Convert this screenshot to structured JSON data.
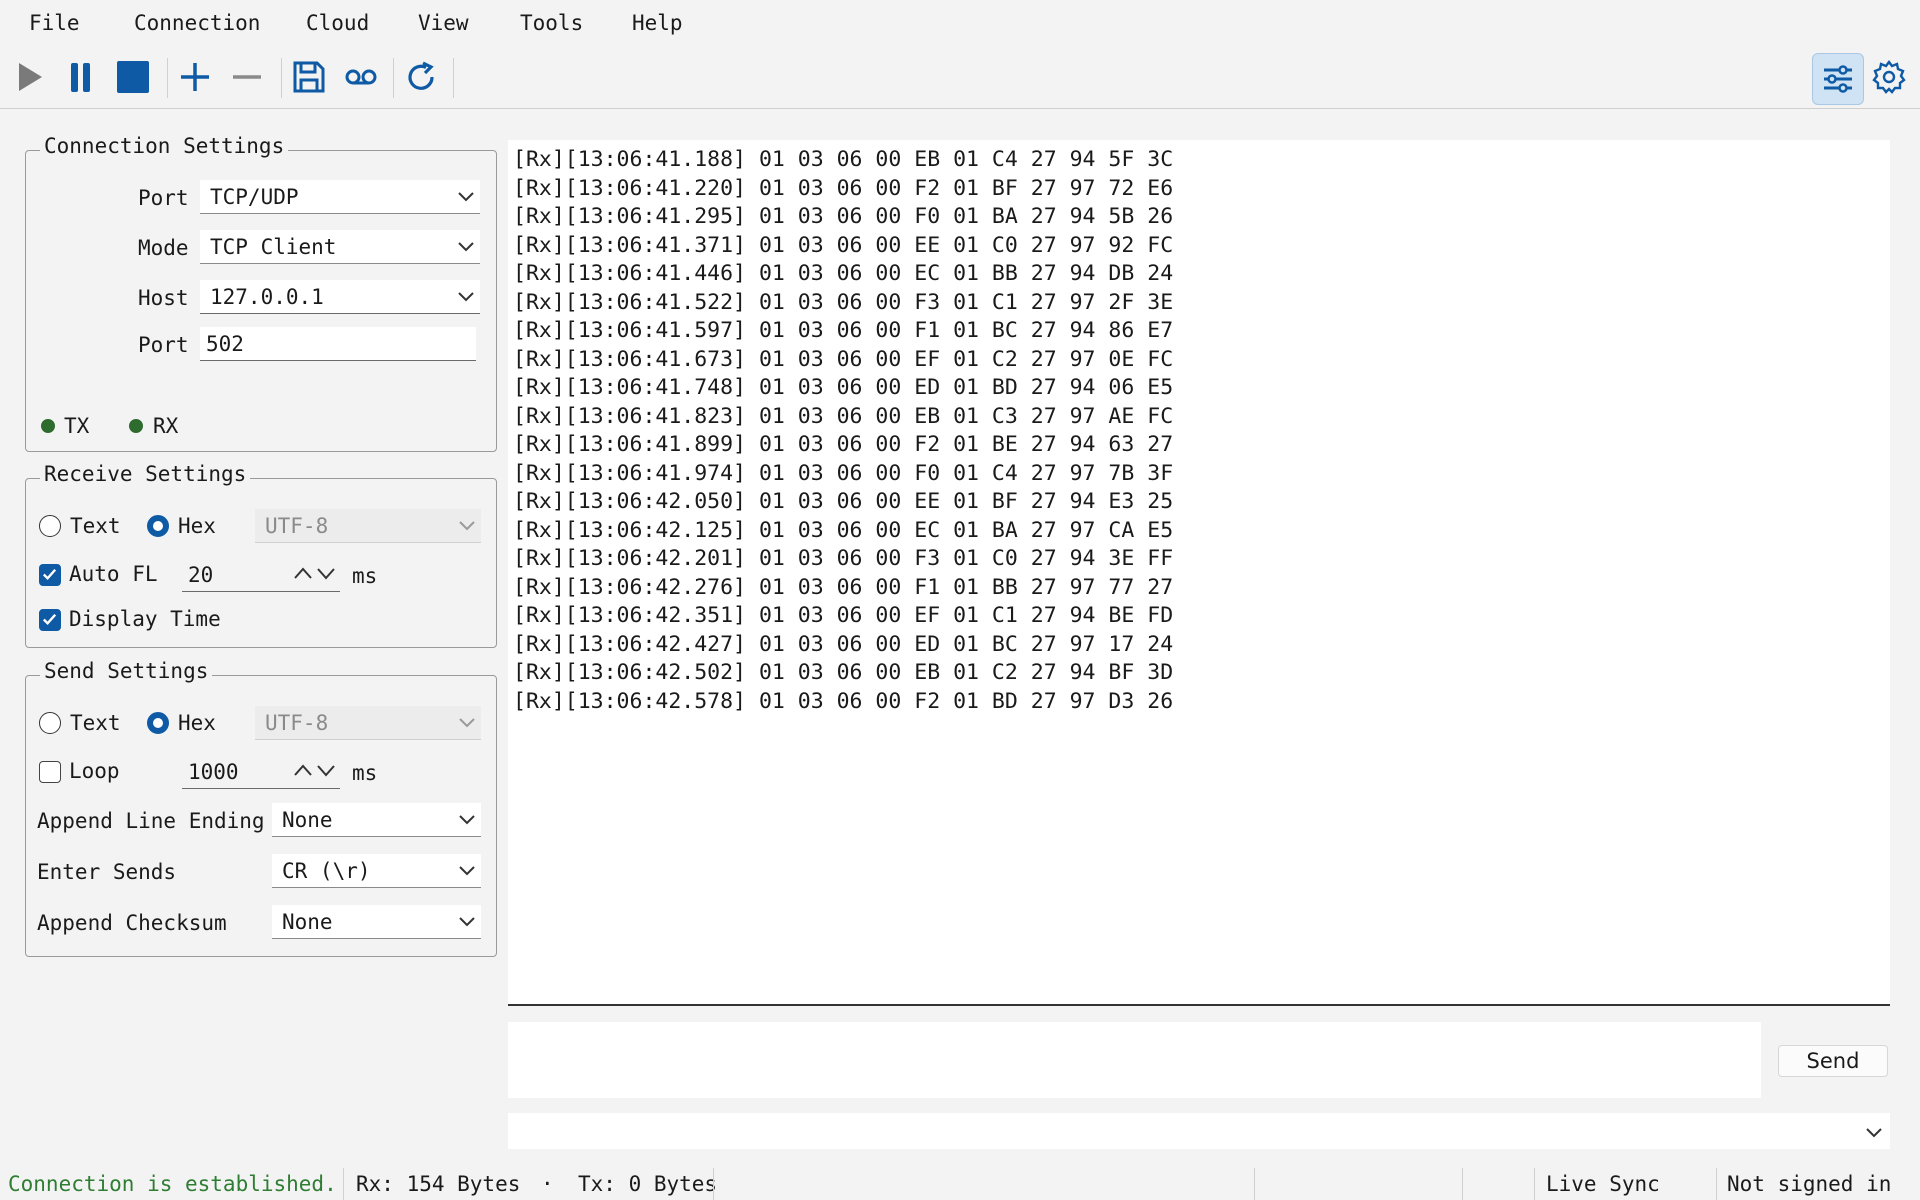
{
  "menu": [
    "File",
    "Connection",
    "Cloud",
    "View",
    "Tools",
    "Help"
  ],
  "toolbar": {
    "icons": [
      "play-icon",
      "pause-icon",
      "stop-icon",
      "add-icon",
      "remove-icon",
      "save-icon",
      "record-icon",
      "refresh-icon",
      "settings-panel-icon",
      "gear-icon"
    ],
    "accent": "#0f5aa5"
  },
  "connection_settings": {
    "title": "Connection Settings",
    "port_label": "Port",
    "port_value": "TCP/UDP",
    "mode_label": "Mode",
    "mode_value": "TCP Client",
    "host_label": "Host",
    "host_value": "127.0.0.1",
    "port2_label": "Port",
    "port2_value": "502",
    "tx_label": "TX",
    "rx_label": "RX"
  },
  "receive_settings": {
    "title": "Receive Settings",
    "text_label": "Text",
    "hex_label": "Hex",
    "encoding": "UTF-8",
    "auto_fl_label": "Auto FL",
    "auto_fl_value": "20",
    "auto_fl_unit": "ms",
    "display_time_label": "Display Time"
  },
  "send_settings": {
    "title": "Send Settings",
    "text_label": "Text",
    "hex_label": "Hex",
    "encoding": "UTF-8",
    "loop_label": "Loop",
    "loop_value": "1000",
    "loop_unit": "ms",
    "line_ending_label": "Append Line Ending",
    "line_ending_value": "None",
    "enter_sends_label": "Enter Sends",
    "enter_sends_value": "CR (\\r)",
    "checksum_label": "Append Checksum",
    "checksum_value": "None"
  },
  "log": [
    "[Rx][13:06:41.188] 01 03 06 00 EB 01 C4 27 94 5F 3C",
    "[Rx][13:06:41.220] 01 03 06 00 F2 01 BF 27 97 72 E6",
    "[Rx][13:06:41.295] 01 03 06 00 F0 01 BA 27 94 5B 26",
    "[Rx][13:06:41.371] 01 03 06 00 EE 01 C0 27 97 92 FC",
    "[Rx][13:06:41.446] 01 03 06 00 EC 01 BB 27 94 DB 24",
    "[Rx][13:06:41.522] 01 03 06 00 F3 01 C1 27 97 2F 3E",
    "[Rx][13:06:41.597] 01 03 06 00 F1 01 BC 27 94 86 E7",
    "[Rx][13:06:41.673] 01 03 06 00 EF 01 C2 27 97 0E FC",
    "[Rx][13:06:41.748] 01 03 06 00 ED 01 BD 27 94 06 E5",
    "[Rx][13:06:41.823] 01 03 06 00 EB 01 C3 27 97 AE FC",
    "[Rx][13:06:41.899] 01 03 06 00 F2 01 BE 27 94 63 27",
    "[Rx][13:06:41.974] 01 03 06 00 F0 01 C4 27 97 7B 3F",
    "[Rx][13:06:42.050] 01 03 06 00 EE 01 BF 27 94 E3 25",
    "[Rx][13:06:42.125] 01 03 06 00 EC 01 BA 27 97 CA E5",
    "[Rx][13:06:42.201] 01 03 06 00 F3 01 C0 27 94 3E FF",
    "[Rx][13:06:42.276] 01 03 06 00 F1 01 BB 27 97 77 27",
    "[Rx][13:06:42.351] 01 03 06 00 EF 01 C1 27 94 BE FD",
    "[Rx][13:06:42.427] 01 03 06 00 ED 01 BC 27 97 17 24",
    "[Rx][13:06:42.502] 01 03 06 00 EB 01 C2 27 94 BF 3D",
    "[Rx][13:06:42.578] 01 03 06 00 F2 01 BD 27 97 D3 26"
  ],
  "send": {
    "button_label": "Send",
    "input_value": ""
  },
  "status": {
    "connection": "Connection is established.",
    "connection_color": "#2e7d32",
    "rx": "Rx: 154 Bytes",
    "separator": "·",
    "tx": "Tx: 0 Bytes",
    "live_sync": "Live Sync",
    "signin": "Not signed in"
  }
}
